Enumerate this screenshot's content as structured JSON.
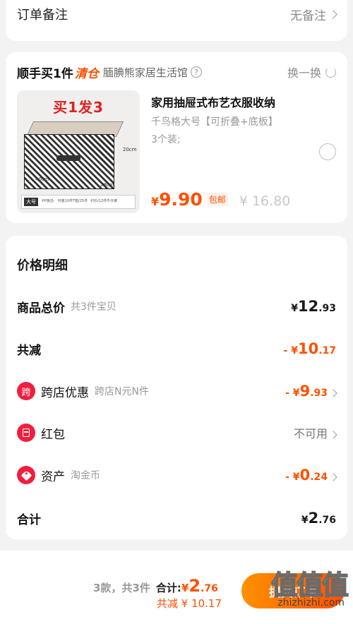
{
  "order_note": {
    "label": "订单备注",
    "value": "无备注"
  },
  "promo": {
    "title": "顺手买1件",
    "tag": "清仓",
    "shop": "腼腆熊家居生活馆",
    "help_icon": "question-icon",
    "swap_label": "换一换",
    "product": {
      "image_headline": "买1发3",
      "image_dims": {
        "width": "40cm",
        "depth": "28cm",
        "height": "20cm"
      },
      "image_size_tag": "大号",
      "image_strip_text_1": "-PP板託-",
      "image_strip_text_2": "可装10件T恤/25件",
      "image_strip_text_3": "衬衫/12件牛仔裤",
      "name": "家用抽屉式布艺衣服收纳",
      "spec": "千鸟格大号【可折叠+底板】",
      "spec2": "3个装;",
      "currency": "¥",
      "price": "9.90",
      "shipping": "包邮",
      "original_price": "¥ 16.80"
    }
  },
  "detail": {
    "title": "价格明细",
    "rows": {
      "subtotal": {
        "label": "商品总价",
        "sub": "共3件宝贝",
        "sy": "¥ ",
        "int": "12",
        "dec": ".93"
      },
      "discount": {
        "label": "共减",
        "sy": "- ¥ ",
        "int": "10",
        "dec": ".17"
      },
      "cross_store": {
        "icon_text": "跨",
        "label": "跨店优惠",
        "sub": "跨店N元N件",
        "sy": "- ¥ ",
        "int": "9",
        "dec": ".93"
      },
      "red_packet": {
        "label": "红包",
        "value": "不可用"
      },
      "assets": {
        "label": "资产",
        "sub": "淘金币",
        "sy": "- ¥ ",
        "int": "0",
        "dec": ".24"
      },
      "total": {
        "label": "合计",
        "sy": "¥ ",
        "int": "2",
        "dec": ".76"
      }
    }
  },
  "bottom_bar": {
    "count": "3款，共3件",
    "total_label": "合计:",
    "sy": "¥",
    "int": "2",
    "dec": ".76",
    "discount_text": "共减 ¥ 10.17",
    "submit_label": "提交订单"
  },
  "watermark": {
    "glyphs": "值值值",
    "url": "zhizhizhi.com"
  },
  "colors": {
    "accent": "#ff5000",
    "badge_red": "#ef1f3f",
    "muted": "#999999"
  }
}
